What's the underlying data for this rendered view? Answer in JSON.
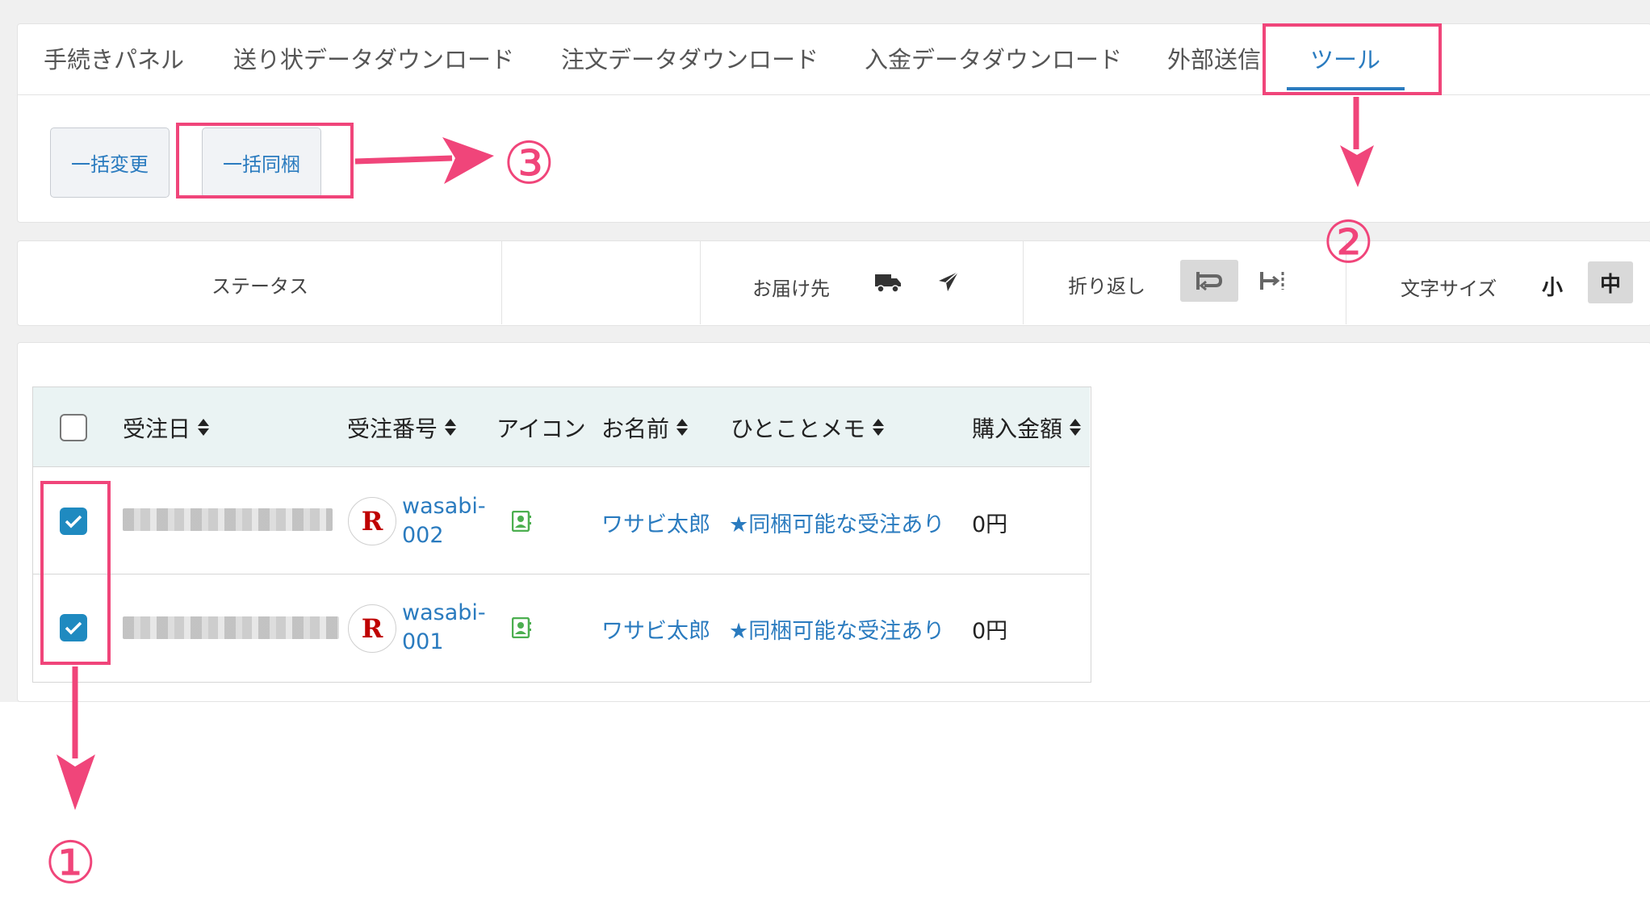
{
  "tabs": [
    {
      "label": "手続きパネル",
      "active": false
    },
    {
      "label": "送り状データダウンロード",
      "active": false
    },
    {
      "label": "注文データダウンロード",
      "active": false
    },
    {
      "label": "入金データダウンロード",
      "active": false
    },
    {
      "label": "外部送信",
      "active": false
    },
    {
      "label": "ツール",
      "active": true
    }
  ],
  "tools": {
    "bulk_change_label": "一括変更",
    "bulk_bundle_label": "一括同梱"
  },
  "controls": {
    "status_label": "ステータス",
    "delivery_label": "お届け先",
    "delivery_icons": [
      "truck-icon",
      "airplane-icon"
    ],
    "wrap_label": "折り返し",
    "wrap_icons": [
      "wrap-on-icon",
      "wrap-off-icon"
    ],
    "wrap_selected": "wrap-on-icon",
    "font_size_label": "文字サイズ",
    "font_size_options": [
      "小",
      "中"
    ],
    "font_size_selected": "中"
  },
  "table": {
    "columns": [
      "受注日",
      "受注番号",
      "アイコン",
      "お名前",
      "ひとことメモ",
      "購入金額"
    ],
    "rows": [
      {
        "checked": true,
        "order_date": "",
        "shop_logo": "R",
        "order_no_line1": "wasabi-",
        "order_no_line2": "002",
        "icon": "contact-icon",
        "name": "ワサビ太郎",
        "memo": "★同梱可能な受注あり",
        "amount": "0円"
      },
      {
        "checked": true,
        "order_date": "",
        "shop_logo": "R",
        "order_no_line1": "wasabi-",
        "order_no_line2": "001",
        "icon": "contact-icon",
        "name": "ワサビ太郎",
        "memo": "★同梱可能な受注あり",
        "amount": "0円"
      }
    ]
  },
  "annotations": {
    "step1": "①",
    "step2": "②",
    "step3": "③",
    "color": "#f0457a"
  },
  "colors": {
    "accent": "#2a7bbf",
    "checkbox": "#1f8ac0",
    "header_bg": "#eaf3f3",
    "rakuten_red": "#bf0000"
  }
}
